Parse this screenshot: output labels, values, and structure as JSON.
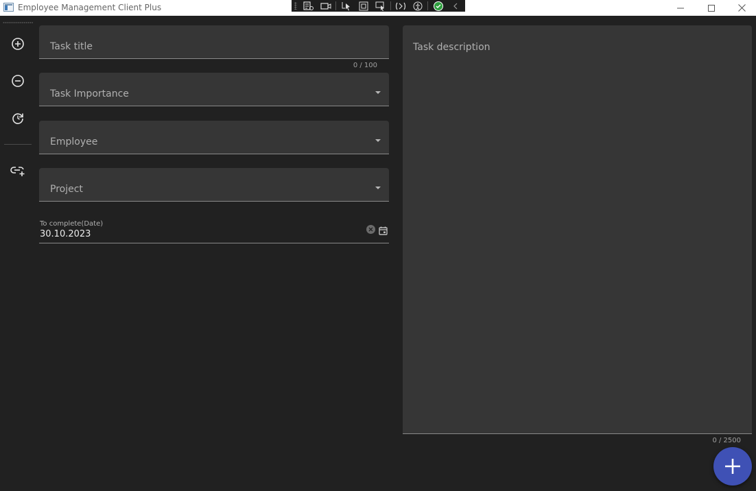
{
  "window": {
    "title": "Employee Management Client Plus"
  },
  "form": {
    "task_title": {
      "label": "Task title",
      "value": "",
      "counter": "0 / 100"
    },
    "task_importance": {
      "label": "Task Importance",
      "value": ""
    },
    "employee": {
      "label": "Employee",
      "value": ""
    },
    "project": {
      "label": "Project",
      "value": ""
    },
    "due_date": {
      "label": "To complete(Date)",
      "value": "30.10.2023"
    },
    "description": {
      "label": "Task description",
      "value": "",
      "counter": "0 / 2500"
    }
  },
  "rail": {
    "items": [
      {
        "icon": "add-circle-icon"
      },
      {
        "icon": "remove-circle-icon"
      },
      {
        "icon": "refresh-icon"
      },
      {
        "icon": "link-add-icon"
      }
    ]
  },
  "colors": {
    "background": "#212121",
    "field": "#363636",
    "accent": "#3f51b5"
  }
}
